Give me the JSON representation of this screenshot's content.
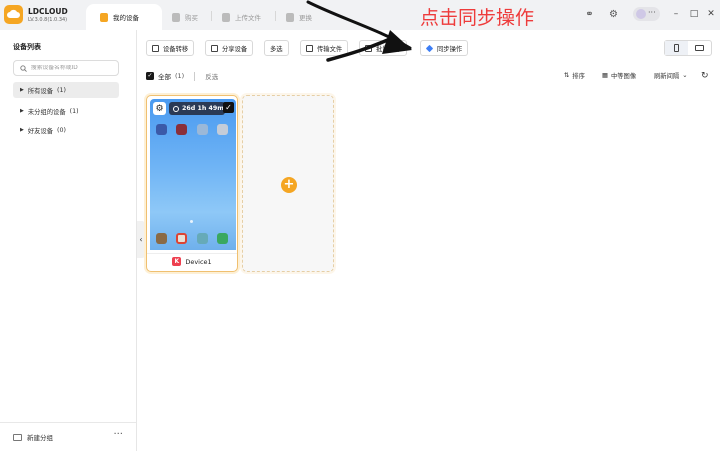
{
  "app": {
    "name": "LDCLOUD",
    "version": "LV.3.0.8(1.0.34)"
  },
  "tabs": [
    {
      "label": "我的设备"
    },
    {
      "label": "购买"
    },
    {
      "label": "上传文件"
    },
    {
      "label": "更换"
    }
  ],
  "sidebar": {
    "title": "设备列表",
    "search_placeholder": "搜索设备名称或ID",
    "groups": [
      {
        "label": "所有设备",
        "count": "(1)"
      },
      {
        "label": "未分组的设备",
        "count": "(1)"
      },
      {
        "label": "好友设备",
        "count": "(0)"
      }
    ],
    "new_group_label": "新建分组",
    "more_glyph": "···"
  },
  "toolbar": {
    "transfer": "设备转移",
    "share": "分享设备",
    "multi_select": "多选",
    "transfer_file": "传输文件",
    "batch": "批量操作",
    "sync": "同步操作"
  },
  "selection": {
    "all_label": "全部",
    "all_count": "(1)",
    "invert_label": "反选"
  },
  "right_tools": {
    "sort": "排序",
    "image_quality": "中等图像",
    "refresh_interval": "刷新间隔"
  },
  "device": {
    "name": "Device1",
    "timer": "26d 1h 49m"
  },
  "annotation": {
    "text": "点击同步操作",
    "color": "#ee3b3b"
  },
  "colors": {
    "accent": "#f5a623",
    "sync_blue": "#3d7ef5"
  }
}
